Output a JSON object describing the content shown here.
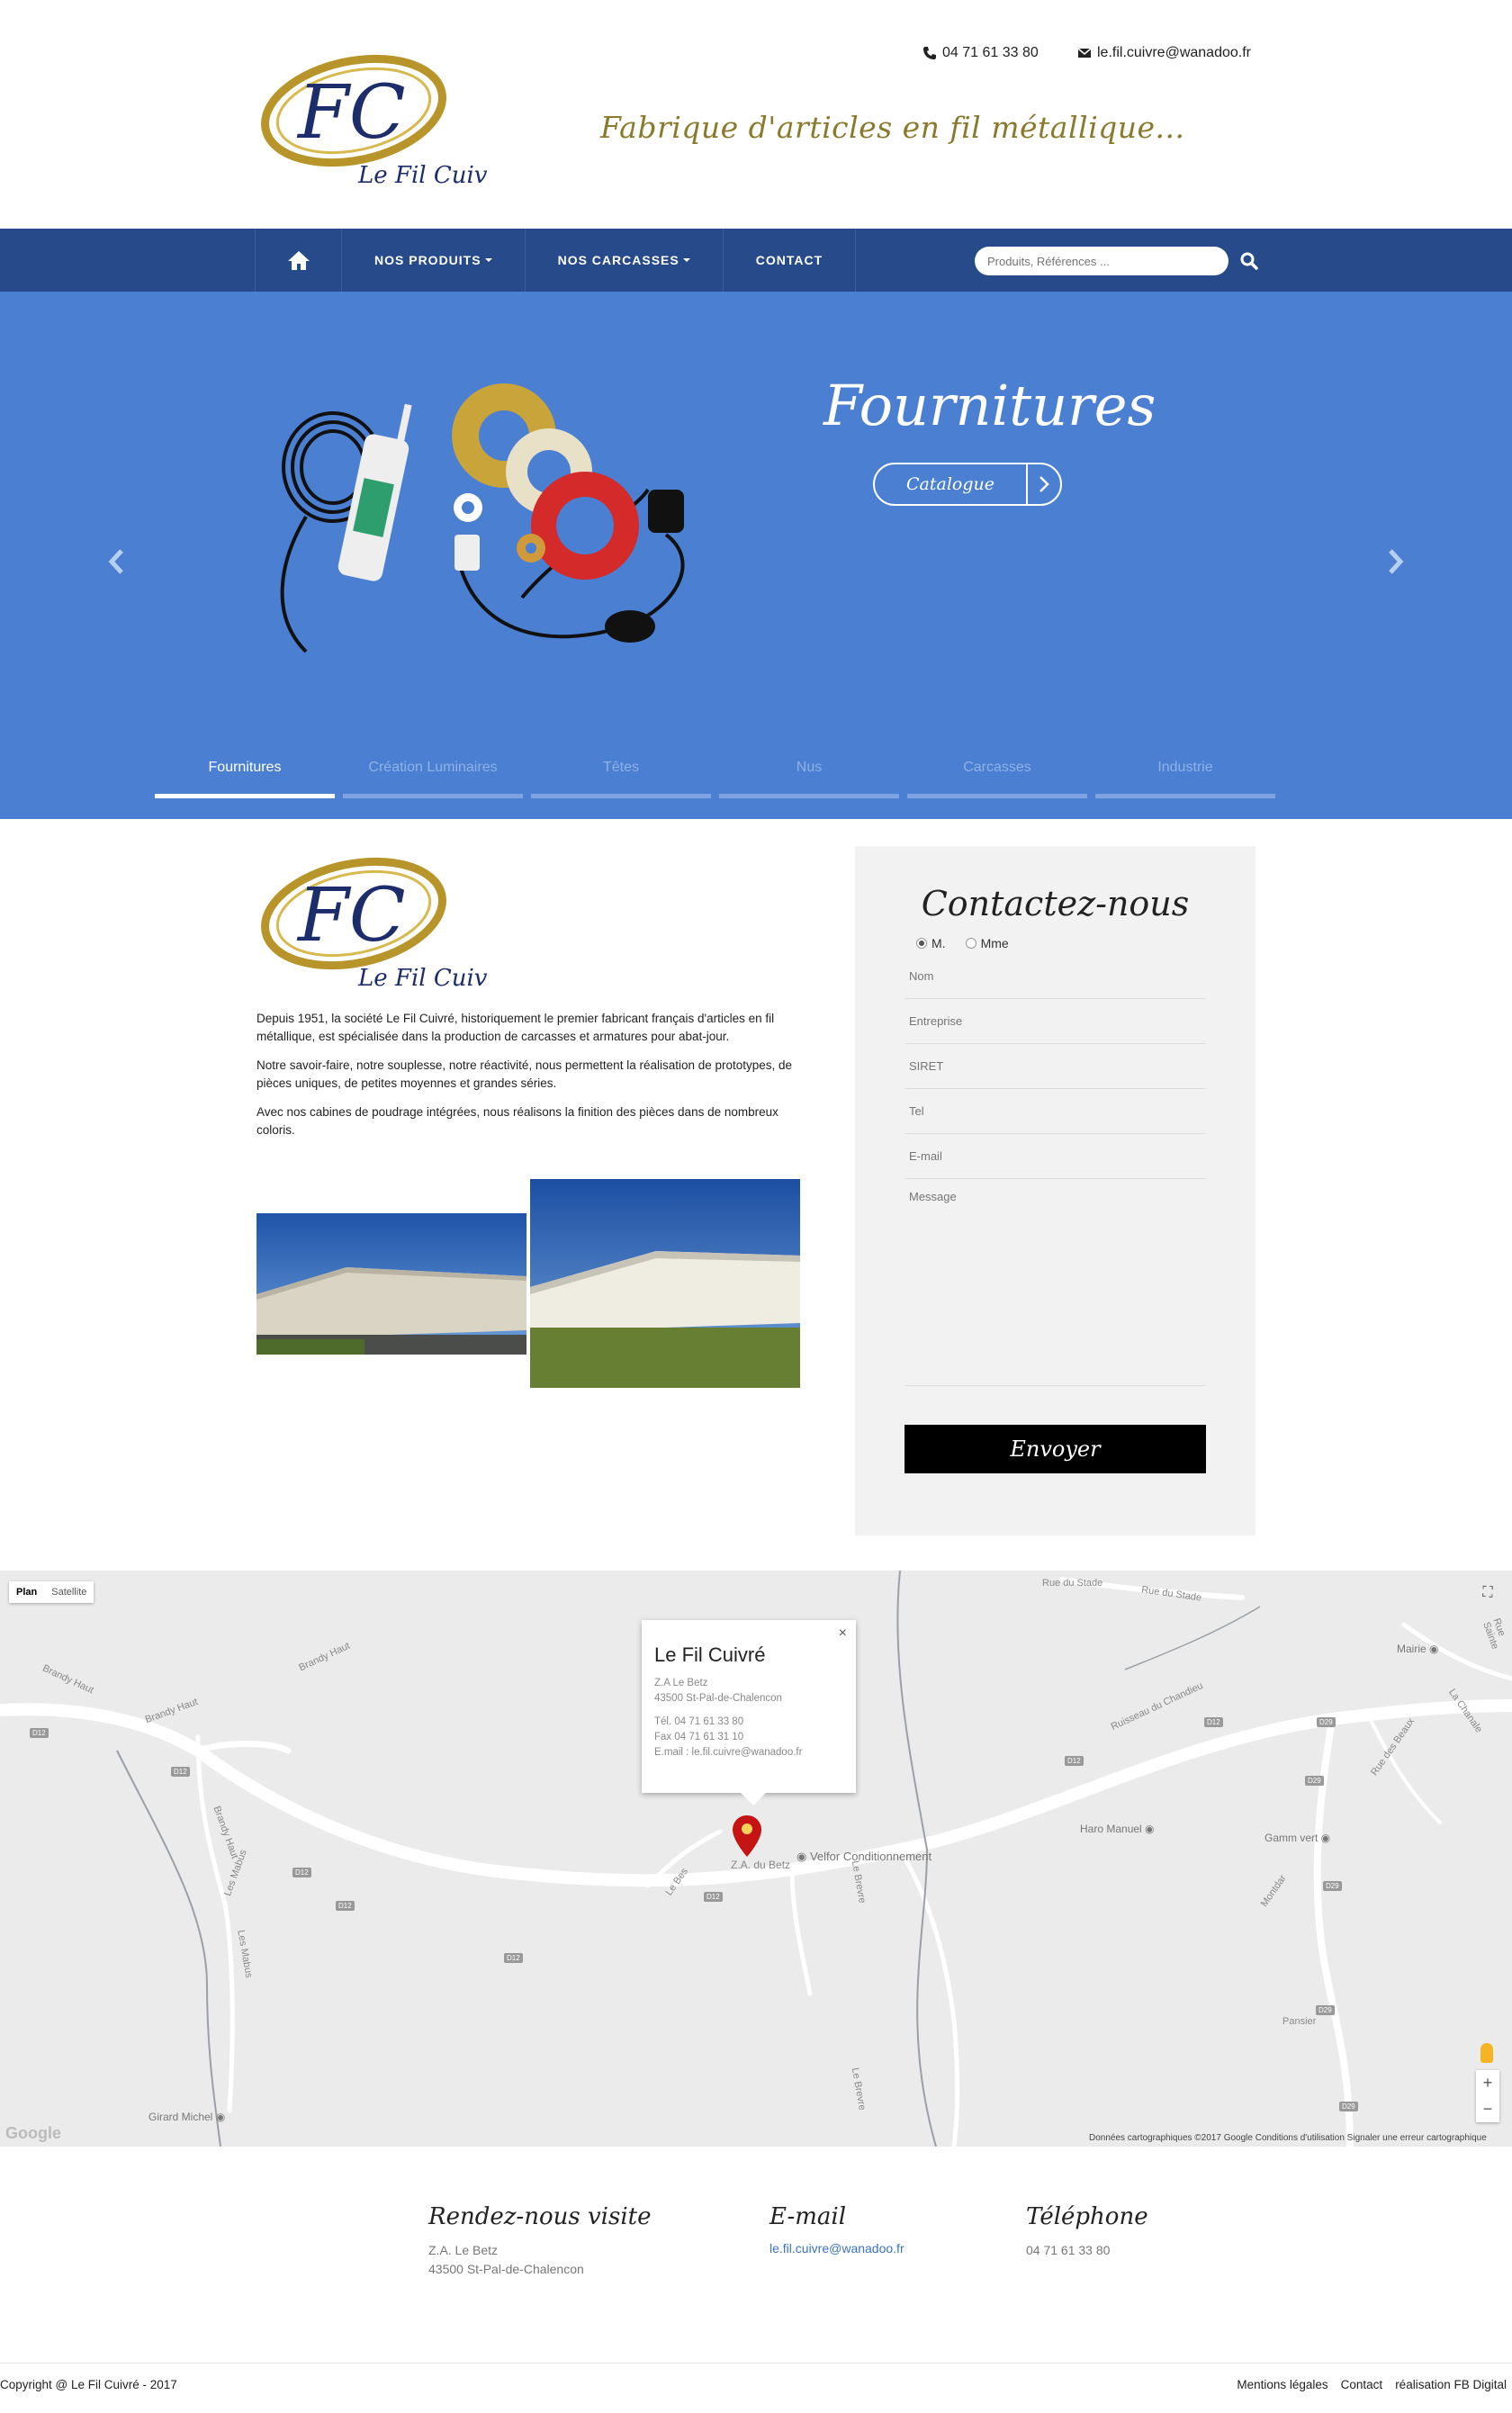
{
  "header": {
    "logo_letters": "FC",
    "logo_name": "Le Fil Cuivré",
    "tagline": "Fabrique d'articles en fil métallique...",
    "phone": "04 71 61 33 80",
    "email": "le.fil.cuivre@wanadoo.fr"
  },
  "nav": {
    "home_icon": "home-icon",
    "items": [
      {
        "label": "NOS PRODUITS",
        "dropdown": true
      },
      {
        "label": "NOS CARCASSES",
        "dropdown": true
      },
      {
        "label": "CONTACT",
        "dropdown": false
      }
    ],
    "search_placeholder": "Produits, Références ...",
    "search_icon": "search-icon",
    "color": "#274b8a"
  },
  "hero": {
    "background": "#4a7fd1",
    "title": "Fournitures",
    "button_label": "Catalogue",
    "tabs": [
      {
        "label": "Fournitures",
        "active": true
      },
      {
        "label": "Création Luminaires",
        "active": false
      },
      {
        "label": "Têtes",
        "active": false
      },
      {
        "label": "Nus",
        "active": false
      },
      {
        "label": "Carcasses",
        "active": false
      },
      {
        "label": "Industrie",
        "active": false
      }
    ]
  },
  "intro": {
    "paragraphs": [
      "Depuis 1951, la société Le Fil Cuivré, historiquement le premier fabricant français d'articles en fil métallique, est spécialisée dans la production de carcasses et armatures pour abat-jour.",
      "Notre savoir-faire, notre souplesse, notre réactivité, nous permettent la réalisation de prototypes, de pièces uniques, de petites moyennes et grandes séries.",
      "Avec nos cabines de poudrage intégrées, nous réalisons la finition des pièces dans de nombreux coloris."
    ]
  },
  "contact_form": {
    "title": "Contactez-nous",
    "civility": [
      {
        "label": "M.",
        "selected": true
      },
      {
        "label": "Mme",
        "selected": false
      }
    ],
    "fields": [
      {
        "placeholder": "Nom",
        "value": ""
      },
      {
        "placeholder": "Entreprise",
        "value": ""
      },
      {
        "placeholder": "SIRET",
        "value": ""
      },
      {
        "placeholder": "Tel",
        "value": ""
      },
      {
        "placeholder": "E-mail",
        "value": ""
      }
    ],
    "message_placeholder": "Message",
    "submit_label": "Envoyer"
  },
  "map": {
    "type_buttons": [
      "Plan",
      "Satellite"
    ],
    "selected_type": "Plan",
    "info": {
      "title": "Le Fil Cuivré",
      "lines": [
        "Z.A Le Betz",
        "43500 St-Pal-de-Chalencon",
        "",
        "Tél. 04 71 61 33 80",
        "Fax 04 71 61 31 10",
        "E.mail : le.fil.cuivre@wanadoo.fr"
      ]
    },
    "labels": {
      "za": "Z.A. du Betz",
      "velfor": "Velfor Conditionnement",
      "haro": "Haro Manuel",
      "gamm": "Gamm vert",
      "mairie": "Mairie",
      "girard": "Girard Michel",
      "stade1": "Rue du Stade",
      "stade2": "Rue du Stade",
      "chandieu": "Ruisseau du Chandieu",
      "brandy1": "Brandy Haut",
      "brandy2": "Brandy Haut",
      "brandy3": "Brandy Haut",
      "brandy4": "Brandy Haut",
      "mabus1": "Les Mabus",
      "mabus2": "Les Mabus",
      "bes": "Le Bes",
      "brevre1": "Le Brevre",
      "brevre2": "Le Brevre",
      "pansier": "Pansier",
      "montdar": "Montdar",
      "beaux": "Rue des Beaux",
      "chanale": "La Chanale",
      "sainte": "Rue Sainte"
    },
    "shields": [
      "D12",
      "D12",
      "D12",
      "D12",
      "D12",
      "D12",
      "D12",
      "D12",
      "D29",
      "D29",
      "D29",
      "D29",
      "D29"
    ],
    "attribution": "Données cartographiques ©2017 Google    Conditions d'utilisation    Signaler une erreur cartographique",
    "google": "Google"
  },
  "footer": {
    "visit_title": "Rendez-nous visite",
    "address_1": "Z.A. Le Betz",
    "address_2": "43500 St-Pal-de-Chalencon",
    "email_title": "E-mail",
    "email": "le.fil.cuivre@wanadoo.fr",
    "phone_title": "Téléphone",
    "phone": "04 71 61 33 80",
    "copyright": "Copyright @ Le Fil Cuivré - 2017",
    "links": [
      "Mentions légales",
      "Contact",
      "réalisation FB Digital"
    ]
  }
}
